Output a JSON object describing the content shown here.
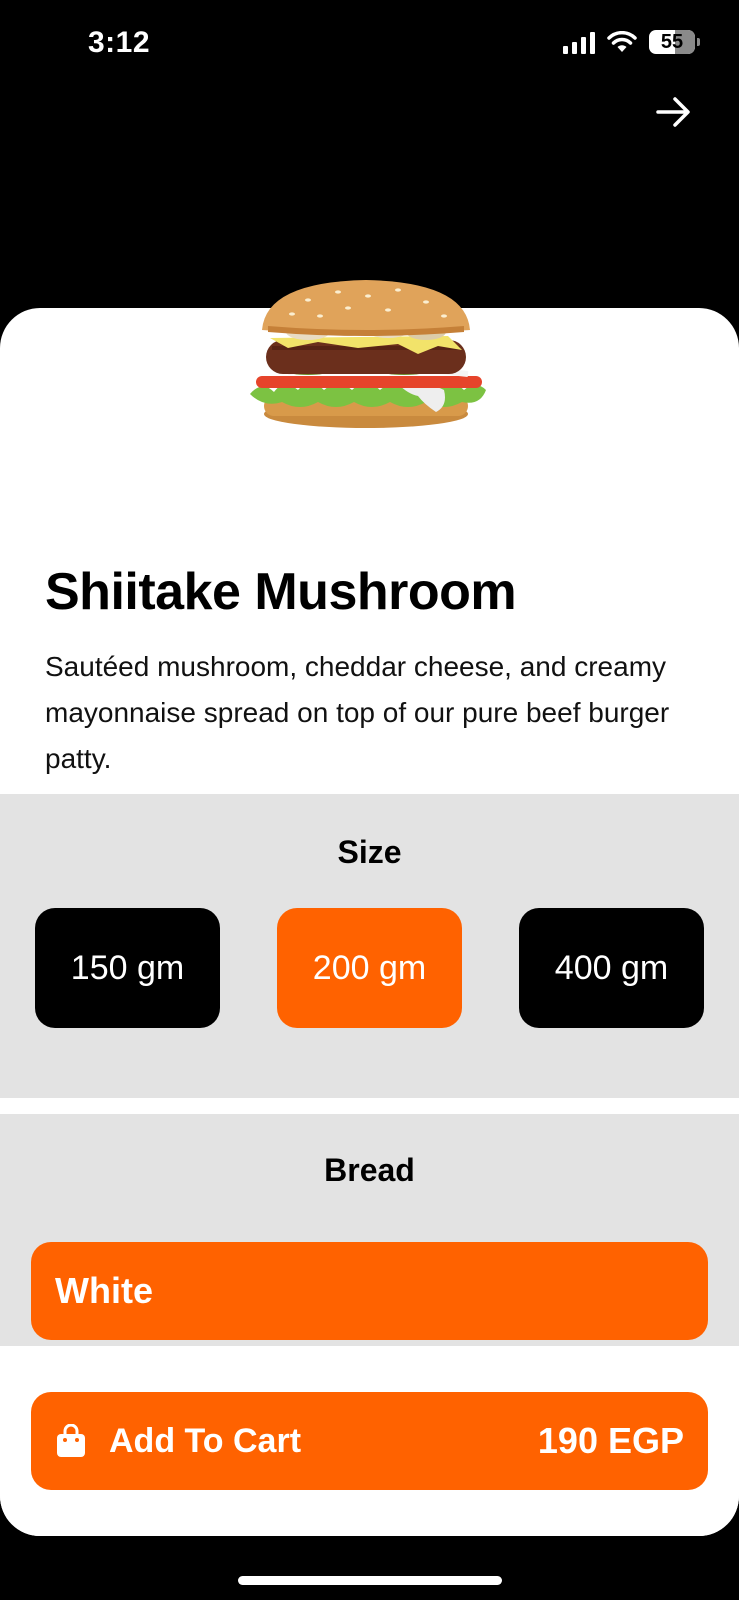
{
  "status_bar": {
    "time": "3:12",
    "battery": "55"
  },
  "product": {
    "name": "Shiitake Mushroom",
    "description": "Sautéed mushroom, cheddar cheese, and creamy mayonnaise spread on top of our pure beef burger patty."
  },
  "size": {
    "title": "Size",
    "options": [
      "150 gm",
      "200 gm",
      "400 gm"
    ],
    "selected": "200 gm"
  },
  "bread": {
    "title": "Bread",
    "options": [
      "White"
    ],
    "selected": "White"
  },
  "cart": {
    "label": "Add To Cart",
    "price": "190 EGP"
  },
  "colors": {
    "accent": "#ff6200",
    "dark": "#000000",
    "section_bg": "#e3e3e3"
  }
}
